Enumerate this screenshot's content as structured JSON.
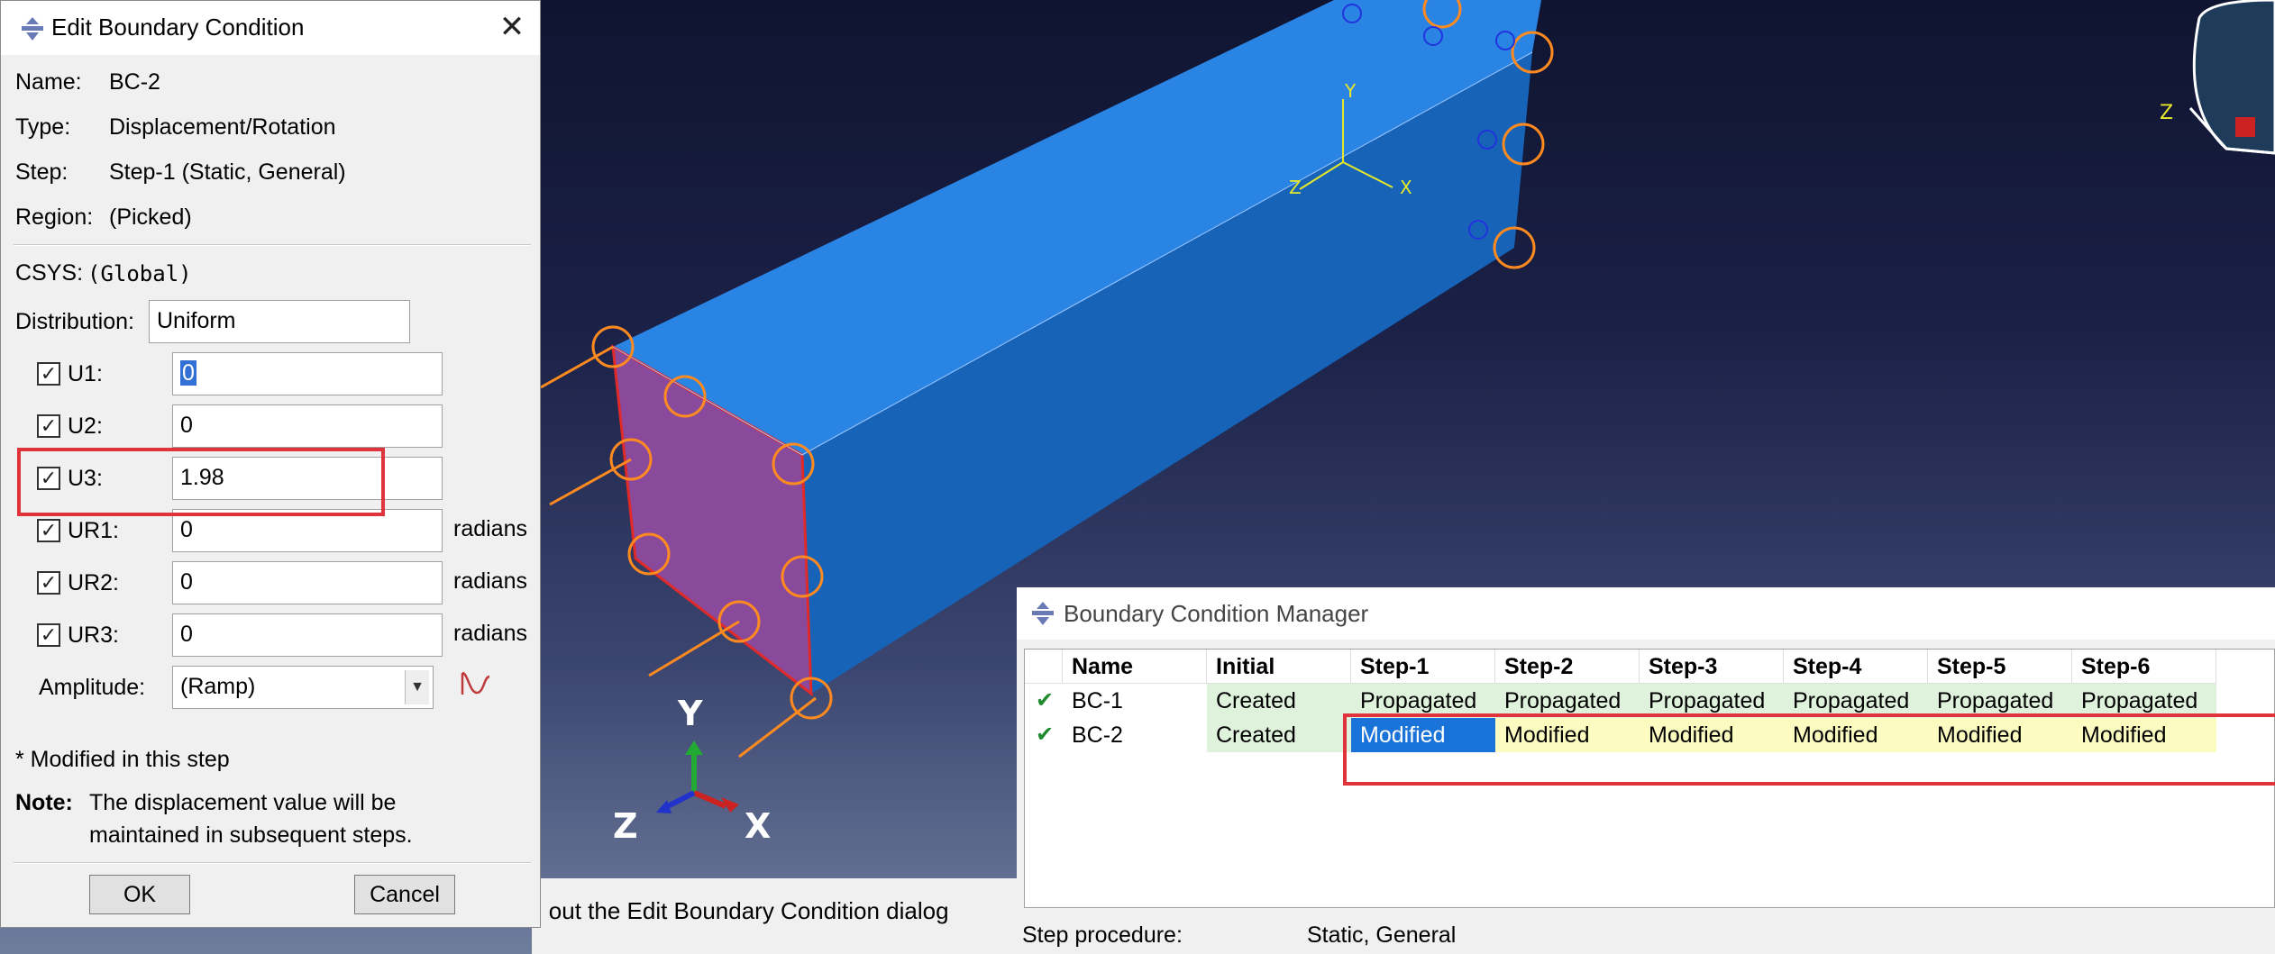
{
  "edit_dialog": {
    "title": "Edit Boundary Condition",
    "name_label": "Name:",
    "name_value": "BC-2",
    "type_label": "Type:",
    "type_value": "Displacement/Rotation",
    "step_label": "Step:",
    "step_value": "Step-1 (Static, General)",
    "region_label": "Region:",
    "region_value": "(Picked)",
    "csys_label": "CSYS:",
    "csys_value": "(Global)",
    "distribution_label": "Distribution:",
    "distribution_value": "Uniform",
    "dofs": [
      {
        "label": "U1:",
        "value": "0",
        "unit": ""
      },
      {
        "label": "U2:",
        "value": "0",
        "unit": ""
      },
      {
        "label": "U3:",
        "value": "1.98",
        "unit": ""
      },
      {
        "label": "UR1:",
        "value": "0",
        "unit": "radians"
      },
      {
        "label": "UR2:",
        "value": "0",
        "unit": "radians"
      },
      {
        "label": "UR3:",
        "value": "0",
        "unit": "radians"
      }
    ],
    "amplitude_label": "Amplitude:",
    "amplitude_value": "(Ramp)",
    "modified_note": "* Modified in this step",
    "note_label": "Note:",
    "note_line1": "The displacement value will be",
    "note_line2": "maintained in subsequent steps.",
    "ok_label": "OK",
    "cancel_label": "Cancel"
  },
  "prompt": {
    "text": "ll out the Edit Boundary Condition dialog"
  },
  "viewport": {
    "triad_small": {
      "y": "Y",
      "z": "Z",
      "x": "X"
    },
    "triad_big": {
      "y": "Y",
      "z": "Z",
      "x": "X"
    },
    "view_cube_label": "Z"
  },
  "manager": {
    "title": "Boundary Condition Manager",
    "columns": [
      "Name",
      "Initial",
      "Step-1",
      "Step-2",
      "Step-3",
      "Step-4",
      "Step-5",
      "Step-6"
    ],
    "rows": [
      {
        "name": "BC-1",
        "initial": "Created",
        "steps": [
          "Propagated",
          "Propagated",
          "Propagated",
          "Propagated",
          "Propagated",
          "Propagated"
        ]
      },
      {
        "name": "BC-2",
        "initial": "Created",
        "steps": [
          "Modified",
          "Modified",
          "Modified",
          "Modified",
          "Modified",
          "Modified"
        ]
      }
    ],
    "status_label": "Step procedure:",
    "status_value": "Static, General"
  },
  "colors": {
    "highlight_box": "#e0333b",
    "model_face": "#1f78d6",
    "fixture": "#ff8a1f",
    "selected_cell": "#1a73d8"
  }
}
